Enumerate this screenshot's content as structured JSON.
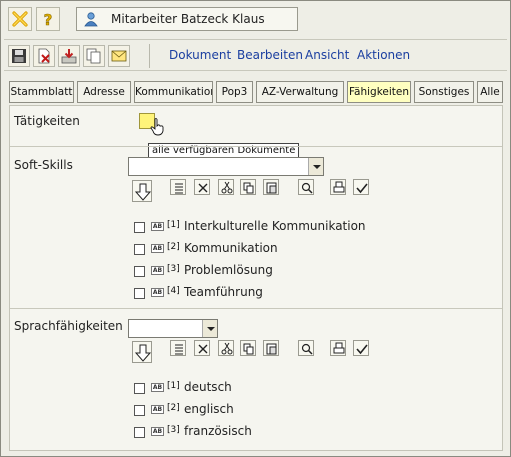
{
  "titlebar": {
    "close_icon": "close-x-icon",
    "help_icon": "help-question-icon",
    "user_icon": "person-icon",
    "title": "Mitarbeiter Batzeck Klaus"
  },
  "toolbar": {
    "tools": [
      "save-icon",
      "delete-icon",
      "export-icon",
      "copy-icon",
      "mail-icon"
    ],
    "menu": [
      "Dokument",
      "Bearbeiten",
      "Ansicht",
      "Aktionen"
    ]
  },
  "tabs": {
    "items": [
      "Stammblatt",
      "Adresse",
      "Kommunikation",
      "Pop3",
      "AZ-Verwaltung",
      "Fähigkeiten",
      "Sonstiges",
      "Alle"
    ],
    "active": "Fähigkeiten"
  },
  "sections": {
    "taetigkeiten": {
      "label": "Tätigkeiten",
      "tooltip": "alle verfügbaren Dokumente"
    },
    "softskills": {
      "label": "Soft-Skills",
      "select_value": "",
      "items": [
        {
          "num": "[1]",
          "label": "Interkulturelle Kommunikation",
          "checked": false
        },
        {
          "num": "[2]",
          "label": "Kommunikation",
          "checked": false
        },
        {
          "num": "[3]",
          "label": "Problemlösung",
          "checked": false
        },
        {
          "num": "[4]",
          "label": "Teamführung",
          "checked": false
        }
      ]
    },
    "sprach": {
      "label": "Sprachfähigkeiten",
      "select_value": "",
      "items": [
        {
          "num": "[1]",
          "label": "deutsch",
          "checked": false
        },
        {
          "num": "[2]",
          "label": "englisch",
          "checked": false
        },
        {
          "num": "[3]",
          "label": "französisch",
          "checked": false
        }
      ]
    },
    "tool_icons": [
      "list-icon",
      "remove-x-icon",
      "cut-icon",
      "copy-icon",
      "paste-icon",
      "search-icon",
      "print-icon",
      "check-icon"
    ],
    "ab_badge": "AB"
  },
  "colors": {
    "link": "#1a3ea0",
    "active_tab": "#ffffc0",
    "panel": "#f5f5ef"
  }
}
